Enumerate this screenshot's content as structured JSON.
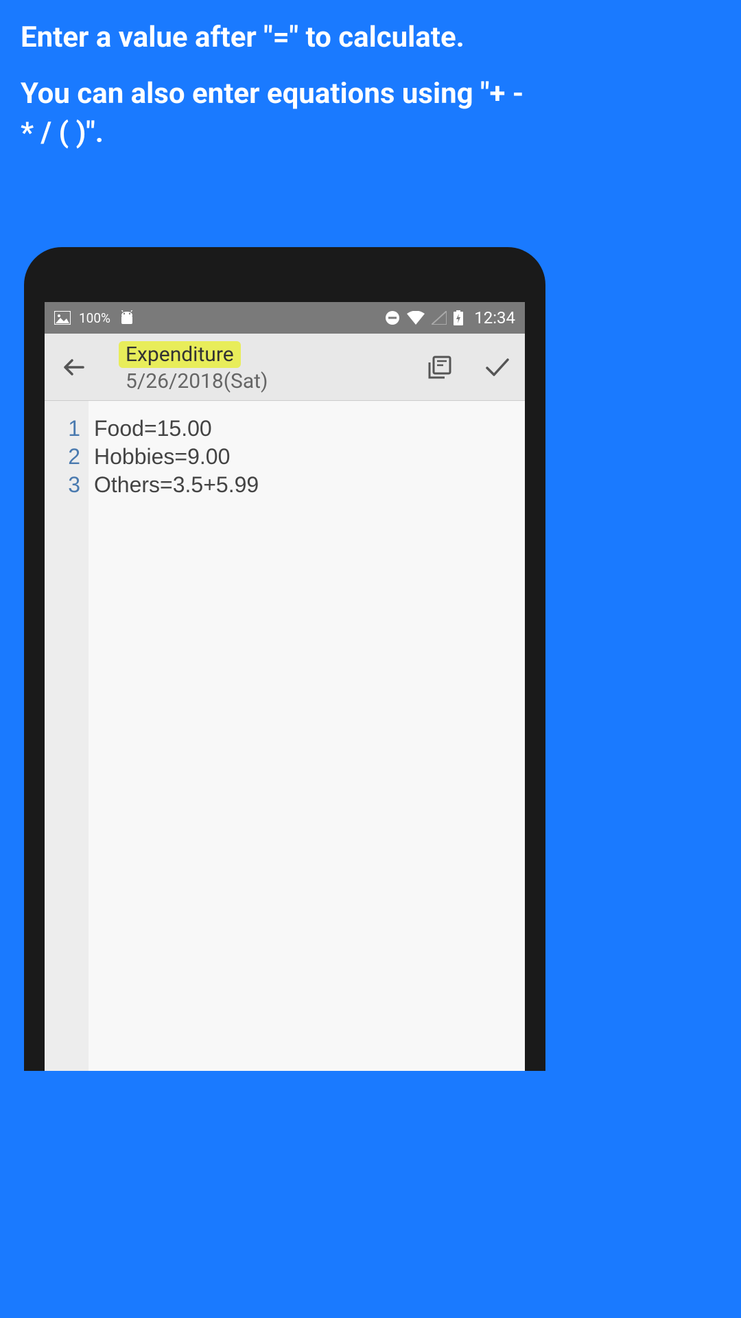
{
  "instructions": {
    "line1": "Enter a value after \"=\" to calculate.",
    "line2": "You can also enter equations using \"+ - * / ( )\"."
  },
  "status_bar": {
    "battery_percent": "100%",
    "time": "12:34"
  },
  "toolbar": {
    "title": "Expenditure",
    "date": "5/26/2018(Sat)"
  },
  "editor": {
    "lines": [
      {
        "num": "1",
        "text": "Food=15.00"
      },
      {
        "num": "2",
        "text": "Hobbies=9.00"
      },
      {
        "num": "3",
        "text": "Others=3.5+5.99"
      }
    ]
  }
}
